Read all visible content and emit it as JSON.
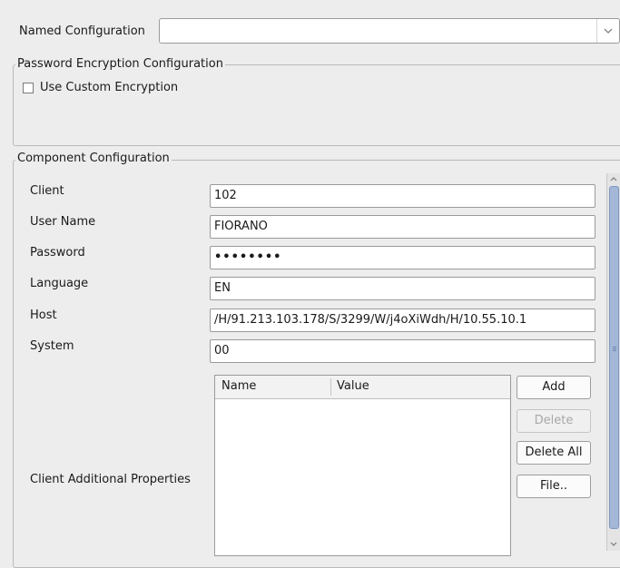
{
  "named_configuration": {
    "label": "Named Configuration",
    "value": "",
    "dropdown_icon": "chevron-down-icon"
  },
  "password_encryption": {
    "title": "Password Encryption Configuration",
    "use_custom_label": "Use Custom Encryption",
    "use_custom_checked": false
  },
  "component_configuration": {
    "title": "Component Configuration",
    "fields": {
      "client": {
        "label": "Client",
        "value": "102"
      },
      "user_name": {
        "label": "User Name",
        "value": "FIORANO"
      },
      "password": {
        "label": "Password",
        "value": "••••••••"
      },
      "language": {
        "label": "Language",
        "value": "EN"
      },
      "host": {
        "label": "Host",
        "value": "/H/91.213.103.178/S/3299/W/j4oXiWdh/H/10.55.10.1"
      },
      "system": {
        "label": "System",
        "value": "00"
      }
    },
    "additional_properties": {
      "label": "Client Additional Properties",
      "columns": [
        "Name",
        "Value"
      ],
      "rows": [],
      "buttons": {
        "add": "Add",
        "delete": "Delete",
        "delete_all": "Delete All",
        "file": "File.."
      }
    }
  }
}
